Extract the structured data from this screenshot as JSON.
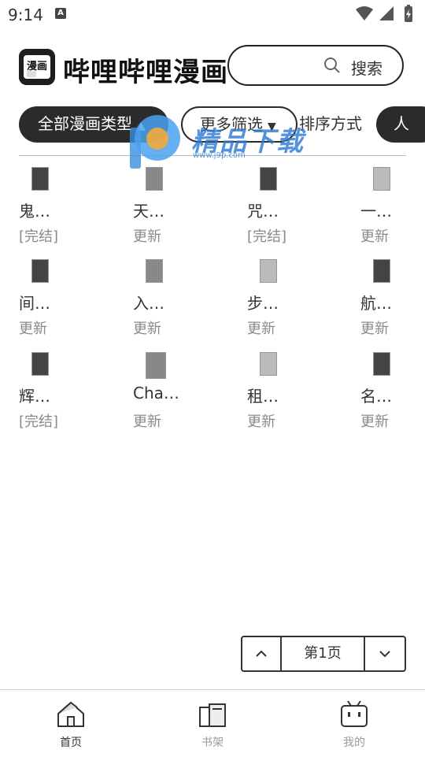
{
  "status_bar": {
    "time": "9:14",
    "notification_letter": "A"
  },
  "header": {
    "logo_glyph": "漫画",
    "app_title": "哔哩哔哩漫画",
    "search_label": "搜索"
  },
  "filters": [
    {
      "label": "全部漫画类型",
      "style": "dark",
      "arrow": "▲"
    },
    {
      "label": "更多筛选",
      "style": "outline",
      "arrow": "▼"
    },
    {
      "label": "排序方式",
      "style": "plain",
      "arrow": ""
    },
    {
      "label": "人",
      "style": "dark",
      "arrow": ""
    }
  ],
  "watermark": {
    "text": "精品下载",
    "url": "www.j9p.com"
  },
  "comics": [
    {
      "title": "鬼…",
      "status": "[完结]"
    },
    {
      "title": "天…",
      "status": "更新"
    },
    {
      "title": "咒…",
      "status": "[完结]"
    },
    {
      "title": "一…",
      "status": "更新"
    },
    {
      "title": "间…",
      "status": "更新"
    },
    {
      "title": "入…",
      "status": "更新"
    },
    {
      "title": "步…",
      "status": "更新"
    },
    {
      "title": "航…",
      "status": "更新"
    },
    {
      "title": "辉…",
      "status": "[完结]"
    },
    {
      "title": "Cha…",
      "status": "更新"
    },
    {
      "title": "租…",
      "status": "更新"
    },
    {
      "title": "名…",
      "status": "更新"
    }
  ],
  "pager": {
    "label": "第1页"
  },
  "tabs": [
    {
      "label": "首页",
      "icon": "home-icon",
      "active": true
    },
    {
      "label": "书架",
      "icon": "bookshelf-icon",
      "active": false
    },
    {
      "label": "我的",
      "icon": "profile-icon",
      "active": false
    }
  ]
}
